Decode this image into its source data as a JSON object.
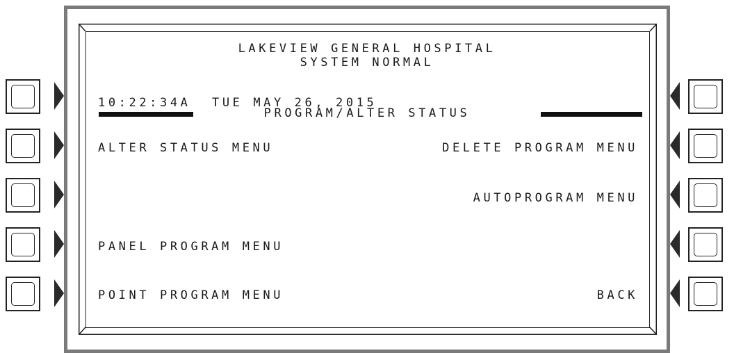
{
  "display": {
    "facility_name": "LAKEVIEW GENERAL HOSPITAL",
    "system_status": "SYSTEM NORMAL",
    "time": "10:22:34A",
    "date": "TUE MAY 26, 2015",
    "screen_title": "PROGRAM/ALTER STATUS"
  },
  "menu": {
    "left": [
      "ALTER STATUS MENU",
      "",
      "PANEL PROGRAM MENU",
      "POINT PROGRAM MENU"
    ],
    "right": [
      "DELETE PROGRAM MENU",
      "AUTOPROGRAM MENU",
      "",
      "BACK"
    ]
  },
  "colors": {
    "bezel": "#7a7a7a",
    "ink": "#1a1a1a"
  }
}
